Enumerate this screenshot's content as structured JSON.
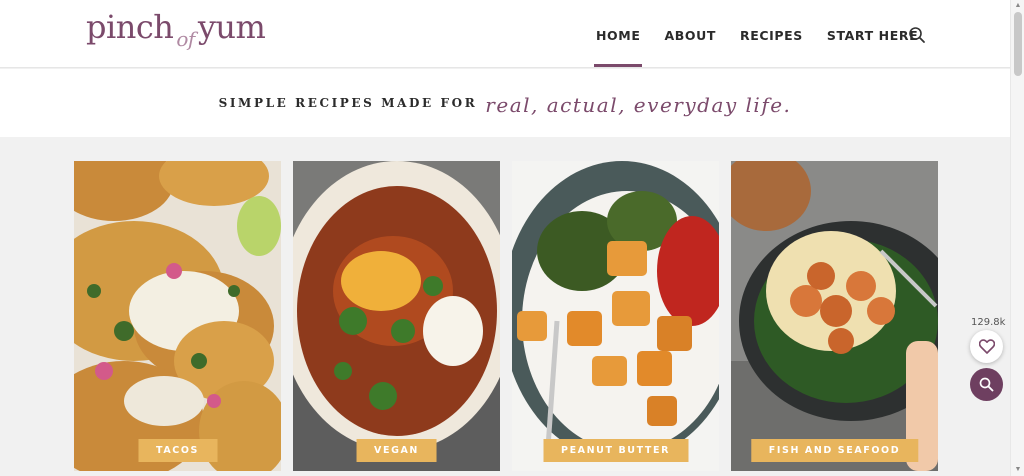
{
  "brand": {
    "logo_part1": "pinch",
    "logo_part2": "of",
    "logo_part3": "yum",
    "accent": "#7b4a6b",
    "label_bg": "#e8b55d"
  },
  "nav": {
    "items": [
      "HOME",
      "ABOUT",
      "RECIPES",
      "START HERE"
    ],
    "active": "HOME",
    "search_icon": "search-icon"
  },
  "tagline": {
    "plain": "SIMPLE RECIPES MADE FOR",
    "script": "real, actual, everyday life."
  },
  "cards": [
    {
      "label": "TACOS"
    },
    {
      "label": "VEGAN"
    },
    {
      "label": "PEANUT BUTTER"
    },
    {
      "label": "FISH AND SEAFOOD"
    }
  ],
  "side": {
    "favorites_count": "129.8k",
    "heart_icon": "heart-icon",
    "search_icon": "search-icon"
  }
}
